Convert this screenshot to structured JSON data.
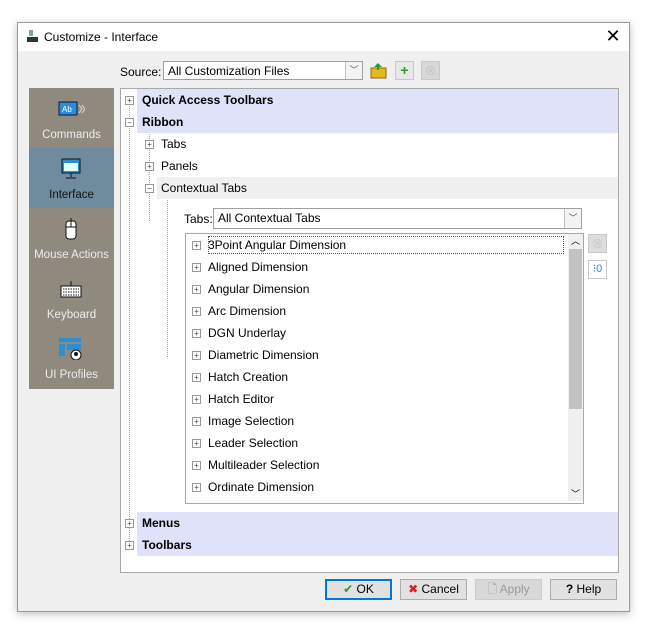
{
  "window": {
    "title": "Customize - Interface",
    "close_icon": "close-icon"
  },
  "source": {
    "label": "Source:",
    "value": "All Customization Files"
  },
  "sidebar": {
    "items": [
      {
        "label": "Commands",
        "icon": "commands-icon"
      },
      {
        "label": "Interface",
        "icon": "interface-icon",
        "selected": true
      },
      {
        "label": "Mouse Actions",
        "icon": "mouse-icon"
      },
      {
        "label": "Keyboard",
        "icon": "keyboard-icon"
      },
      {
        "label": "UI Profiles",
        "icon": "ui-profiles-icon"
      }
    ]
  },
  "tree": {
    "quick_access": "Quick Access Toolbars",
    "ribbon": "Ribbon",
    "tabs": "Tabs",
    "panels": "Panels",
    "contextual": "Contextual Tabs",
    "menus": "Menus",
    "toolbars": "Toolbars"
  },
  "contextual": {
    "tabs_label": "Tabs:",
    "tabs_value": "All Contextual Tabs",
    "items": [
      "3Point Angular Dimension",
      "Aligned Dimension",
      "Angular Dimension",
      "Arc Dimension",
      "DGN Underlay",
      "Diametric Dimension",
      "Hatch Creation",
      "Hatch Editor",
      "Image Selection",
      "Leader Selection",
      "Multileader Selection",
      "Ordinate Dimension"
    ]
  },
  "buttons": {
    "ok": "OK",
    "cancel": "Cancel",
    "apply": "Apply",
    "help": "Help"
  },
  "colors": {
    "highlight": "#dfe2f8",
    "sidebar": "#8f897e",
    "sidebar_selected": "#6f8b9e",
    "ok_border": "#0078d7"
  }
}
